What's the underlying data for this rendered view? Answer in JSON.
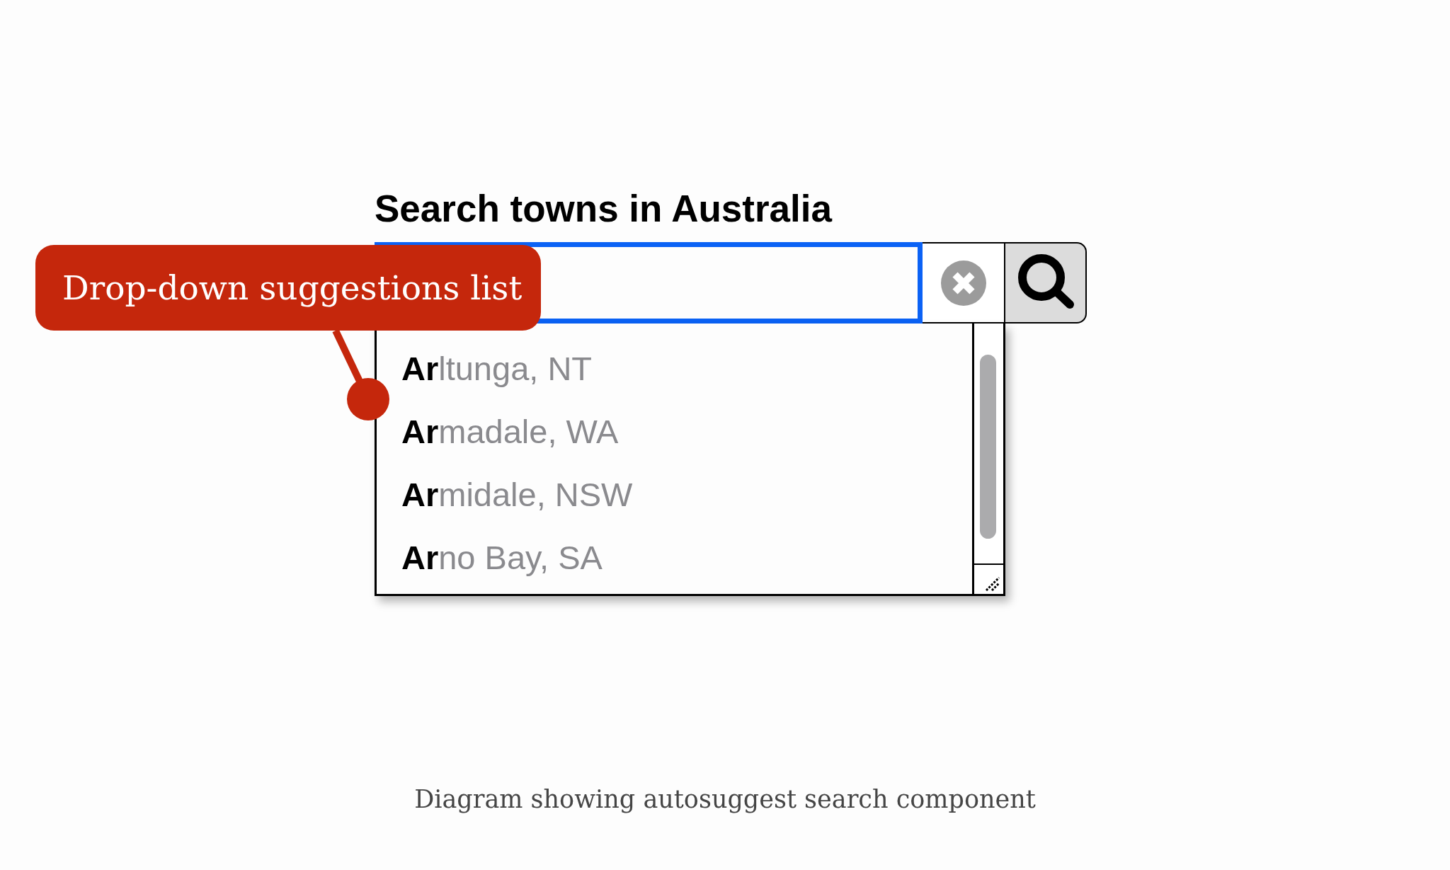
{
  "search": {
    "label": "Search towns in Australia",
    "focused": true
  },
  "suggestions": {
    "items": [
      {
        "label": "**Ar**ltunga, NT",
        "selected": false
      },
      {
        "label": "**Ar**madale, WA",
        "selected": false
      },
      {
        "label": "**Ar**midale, NSW",
        "selected": false
      },
      {
        "label": "**Ar**no Bay, SA",
        "selected": false
      }
    ]
  },
  "callout": {
    "text": "Drop-down suggestions list"
  },
  "caption": "Diagram showing autosuggest search component"
}
